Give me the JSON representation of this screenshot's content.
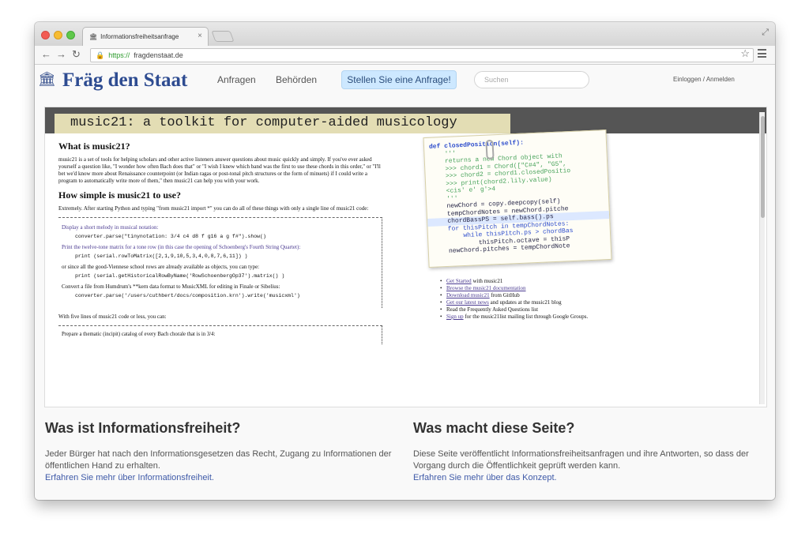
{
  "browser": {
    "tab_title": "Informationsfreiheitsanfrage",
    "url_scheme": "https://",
    "url_host": "fragdenstaat.de"
  },
  "site": {
    "logo": "Fräg den Staat",
    "nav": [
      "Anfragen",
      "Behörden"
    ],
    "cta": "Stellen Sie eine Anfrage!",
    "search_placeholder": "Suchen",
    "login": "Einloggen / Anmelden"
  },
  "music21": {
    "title": "music21: a toolkit for computer-aided musicology",
    "what_heading": "What is music21?",
    "what_text": "music21 is a set of tools for helping scholars and other active listeners answer questions about music quickly and simply. If you've ever asked yourself a question like, \"I wonder how often Bach does that\" or \"I wish I knew which band was the first to use these chords in this order,\" or \"I'll bet we'd know more about Renaissance counterpoint (or Indian ragas or post-tonal pitch structures or the form of minuets) if I could write a program to automatically write more of them,\" then music21 can help you with your work.",
    "simple_heading": "How simple is music21 to use?",
    "simple_text": "Extremely. After starting Python and typing \"from music21 import *\" you can do all of these things with only a single line of music21 code:",
    "examples": [
      {
        "text": "Display a short melody in musical notation:",
        "code": "converter.parse(\"tinynotation: 3/4 c4 d8 f g16 a g f#\").show()"
      },
      {
        "text": "Print the twelve-tone matrix for a tone row (in this case the opening of Schoenberg's Fourth String Quartet):",
        "code": "print (serial.rowToMatrix([2,1,9,10,5,3,4,0,8,7,6,11]) )"
      },
      {
        "text": "or since all the good-Viennese school rows are already available as objects, you can type:",
        "code": "print (serial.getHistoricalRowByName('RowSchoenbergOp37').matrix() )"
      },
      {
        "text": "Convert a file from Humdrum's **kern data format to MusicXML for editing in Finale or Sibelius:",
        "code": "converter.parse('/users/cuthbert/docs/composition.krn').write('musicxml')"
      }
    ],
    "after_text": "With five lines of music21 code or less, you can:",
    "prepare_text": "Prepare a thematic (incipit) catalog of every Bach chorale that is in 3/4:",
    "snippet_lines": [
      "def closedPosition(self):",
      "    '''",
      "    returns a new Chord object with",
      "",
      "    >>> chord1 = Chord([\"C#4\", \"G5\",",
      "    >>> chord2 = chord1.closedPositio",
      "    >>> print(chord2.lily.value)",
      "    <cis' e' g'>4",
      "    '''",
      "    newChord = copy.deepcopy(self)",
      "    tempChordNotes = newChord.pitche",
      "    chordBassPS = self.bass().ps",
      "    for thisPitch in tempChordNotes:",
      "        while thisPitch.ps > chordBas",
      "            thisPitch.octave = thisP",
      "    newChord.pitches = tempChordNote"
    ],
    "links": [
      {
        "link": "Get Started",
        "text": " with music21"
      },
      {
        "link": "Browse the music21 documentation",
        "text": ""
      },
      {
        "link": "Download music21",
        "text": " from GitHub"
      },
      {
        "link": "Get our latest news",
        "text": " and updates at the music21 blog"
      },
      {
        "link": "",
        "text": "Read the Frequently Asked Questions list"
      },
      {
        "link": "Sign up",
        "text": " for the music21list mailing list through Google Groups."
      }
    ]
  },
  "footer": {
    "left": {
      "heading": "Was ist Informationsfreiheit?",
      "text": "Jeder Bürger hat nach den Informationsgesetzen das Recht, Zugang zu Informationen der öffentlichen Hand zu erhalten.",
      "link": "Erfahren Sie mehr über Informationsfreiheit."
    },
    "right": {
      "heading": "Was macht diese Seite?",
      "text": "Diese Seite veröffentlicht Informationsfreiheitsanfragen und ihre Antworten, so dass der Vorgang durch die Öffentlichkeit geprüft werden kann.",
      "link": "Erfahren Sie mehr über das Konzept."
    }
  }
}
